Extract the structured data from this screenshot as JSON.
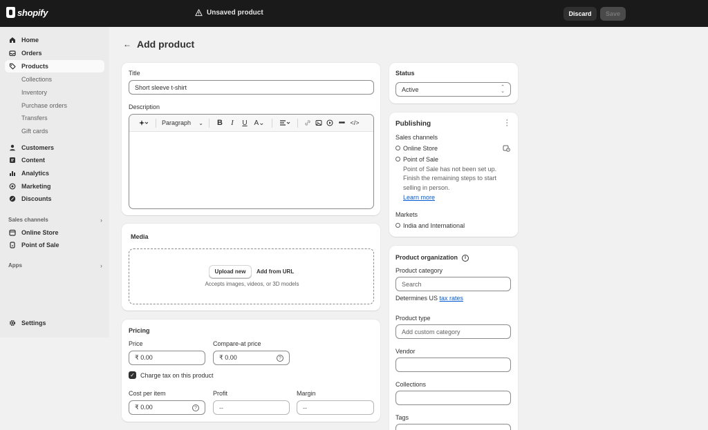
{
  "topbar": {
    "logo_text": "shopify",
    "unsaved_label": "Unsaved product",
    "discard_label": "Discard",
    "save_label": "Save"
  },
  "sidebar": {
    "home": "Home",
    "orders": "Orders",
    "products": "Products",
    "sub": [
      "Collections",
      "Inventory",
      "Purchase orders",
      "Transfers",
      "Gift cards"
    ],
    "customers": "Customers",
    "content": "Content",
    "analytics": "Analytics",
    "marketing": "Marketing",
    "discounts": "Discounts",
    "sales_channels_label": "Sales channels",
    "online_store": "Online Store",
    "point_of_sale": "Point of Sale",
    "apps_label": "Apps",
    "settings": "Settings"
  },
  "page": {
    "title": "Add product"
  },
  "title_card": {
    "title_label": "Title",
    "title_value": "Short sleeve t-shirt",
    "description_label": "Description",
    "paragraph_label": "Paragraph"
  },
  "media": {
    "label": "Media",
    "upload_label": "Upload new",
    "add_url_label": "Add from URL",
    "accepts": "Accepts images, videos, or 3D models"
  },
  "pricing": {
    "label": "Pricing",
    "price_label": "Price",
    "price_value": "₹  0.00",
    "compare_label": "Compare-at price",
    "compare_value": "₹  0.00",
    "charge_tax": "Charge tax on this product",
    "cost_label": "Cost per item",
    "cost_value": "₹  0.00",
    "profit_label": "Profit",
    "profit_value": "--",
    "margin_label": "Margin",
    "margin_value": "--"
  },
  "status": {
    "label": "Status",
    "value": "Active"
  },
  "publishing": {
    "label": "Publishing",
    "sales_channels_label": "Sales channels",
    "online_store": "Online Store",
    "point_of_sale": "Point of Sale",
    "pos_note_1": "Point of Sale has not been set up.",
    "pos_note_2": "Finish the remaining steps to start",
    "pos_note_3": "selling in person.",
    "learn_more": "Learn more",
    "markets_label": "Markets",
    "market_value": "India and International"
  },
  "organization": {
    "label": "Product organization",
    "category_label": "Product category",
    "category_placeholder": "Search",
    "determines_prefix": "Determines US",
    "tax_rates_link": "tax rates",
    "type_label": "Product type",
    "type_placeholder": "Add custom category",
    "vendor_label": "Vendor",
    "collections_label": "Collections",
    "tags_label": "Tags"
  }
}
